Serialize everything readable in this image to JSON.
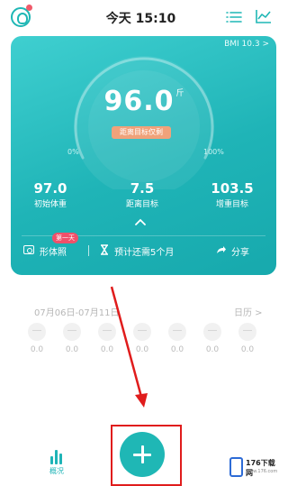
{
  "header": {
    "title": "今天 15:10"
  },
  "card": {
    "bmi_label": "BMI 10.3 >",
    "weight_value": "96.0",
    "weight_unit": "斤",
    "status_chip": "距离目标仅剩",
    "percent_min": "0%",
    "percent_max": "100%",
    "stats": [
      {
        "value": "97.0",
        "label": "初始体重"
      },
      {
        "value": "7.5",
        "label": "距离目标"
      },
      {
        "value": "103.5",
        "label": "增重目标"
      }
    ],
    "body_label": "形体照",
    "day_badge": "第一天",
    "remind_text": "预计还需5个月",
    "share_label": "分享"
  },
  "history": {
    "date_range": "07月06日-07月11日",
    "calendar_label": "日历 >",
    "days": [
      {
        "value": "0.0"
      },
      {
        "value": "0.0"
      },
      {
        "value": "0.0"
      },
      {
        "value": "0.0"
      },
      {
        "value": "0.0"
      },
      {
        "value": "0.0"
      },
      {
        "value": "0.0"
      }
    ]
  },
  "nav": {
    "overview_label": "概况"
  },
  "watermark": {
    "text": "176下载网",
    "sub": "www.176.com"
  },
  "colors": {
    "accent": "#1fb7b5",
    "annotation": "#e01c1c"
  }
}
